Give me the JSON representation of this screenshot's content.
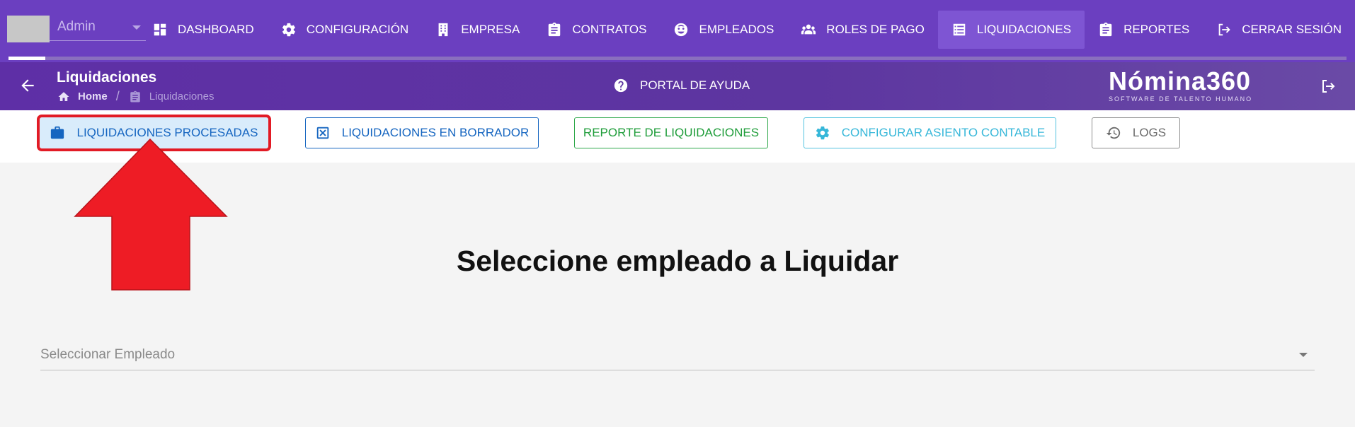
{
  "user": {
    "name": "Admin"
  },
  "nav": [
    {
      "label": "DASHBOARD",
      "icon": "dashboard-icon"
    },
    {
      "label": "CONFIGURACIÓN",
      "icon": "gear-icon"
    },
    {
      "label": "EMPRESA",
      "icon": "building-icon"
    },
    {
      "label": "CONTRATOS",
      "icon": "clipboard-icon"
    },
    {
      "label": "EMPLEADOS",
      "icon": "employee-face-icon"
    },
    {
      "label": "ROLES DE PAGO",
      "icon": "users-icon"
    },
    {
      "label": "LIQUIDACIONES",
      "icon": "list-icon",
      "active": true
    },
    {
      "label": "REPORTES",
      "icon": "clipboard-icon"
    },
    {
      "label": "CERRAR SESIÓN",
      "icon": "logout-icon"
    }
  ],
  "header": {
    "title": "Liquidaciones",
    "breadcrumbs": [
      "Home",
      "Liquidaciones"
    ],
    "help_label": "PORTAL DE AYUDA"
  },
  "logo": {
    "name": "Nómina360",
    "tagline": "SOFTWARE DE TALENTO HUMANO"
  },
  "actions": {
    "processed": "LIQUIDACIONES PROCESADAS",
    "draft": "LIQUIDACIONES EN BORRADOR",
    "report": "REPORTE DE LIQUIDACIONES",
    "config": "CONFIGURAR ASIENTO CONTABLE",
    "logs": "LOGS"
  },
  "main": {
    "heading": "Seleccione empleado a Liquidar",
    "select_placeholder": "Seleccionar Empleado"
  },
  "colors": {
    "topbar": "#6b3fc0",
    "active_nav": "#7e55d3",
    "highlight_red": "#e21b25",
    "primary_blue": "#1565c0"
  }
}
